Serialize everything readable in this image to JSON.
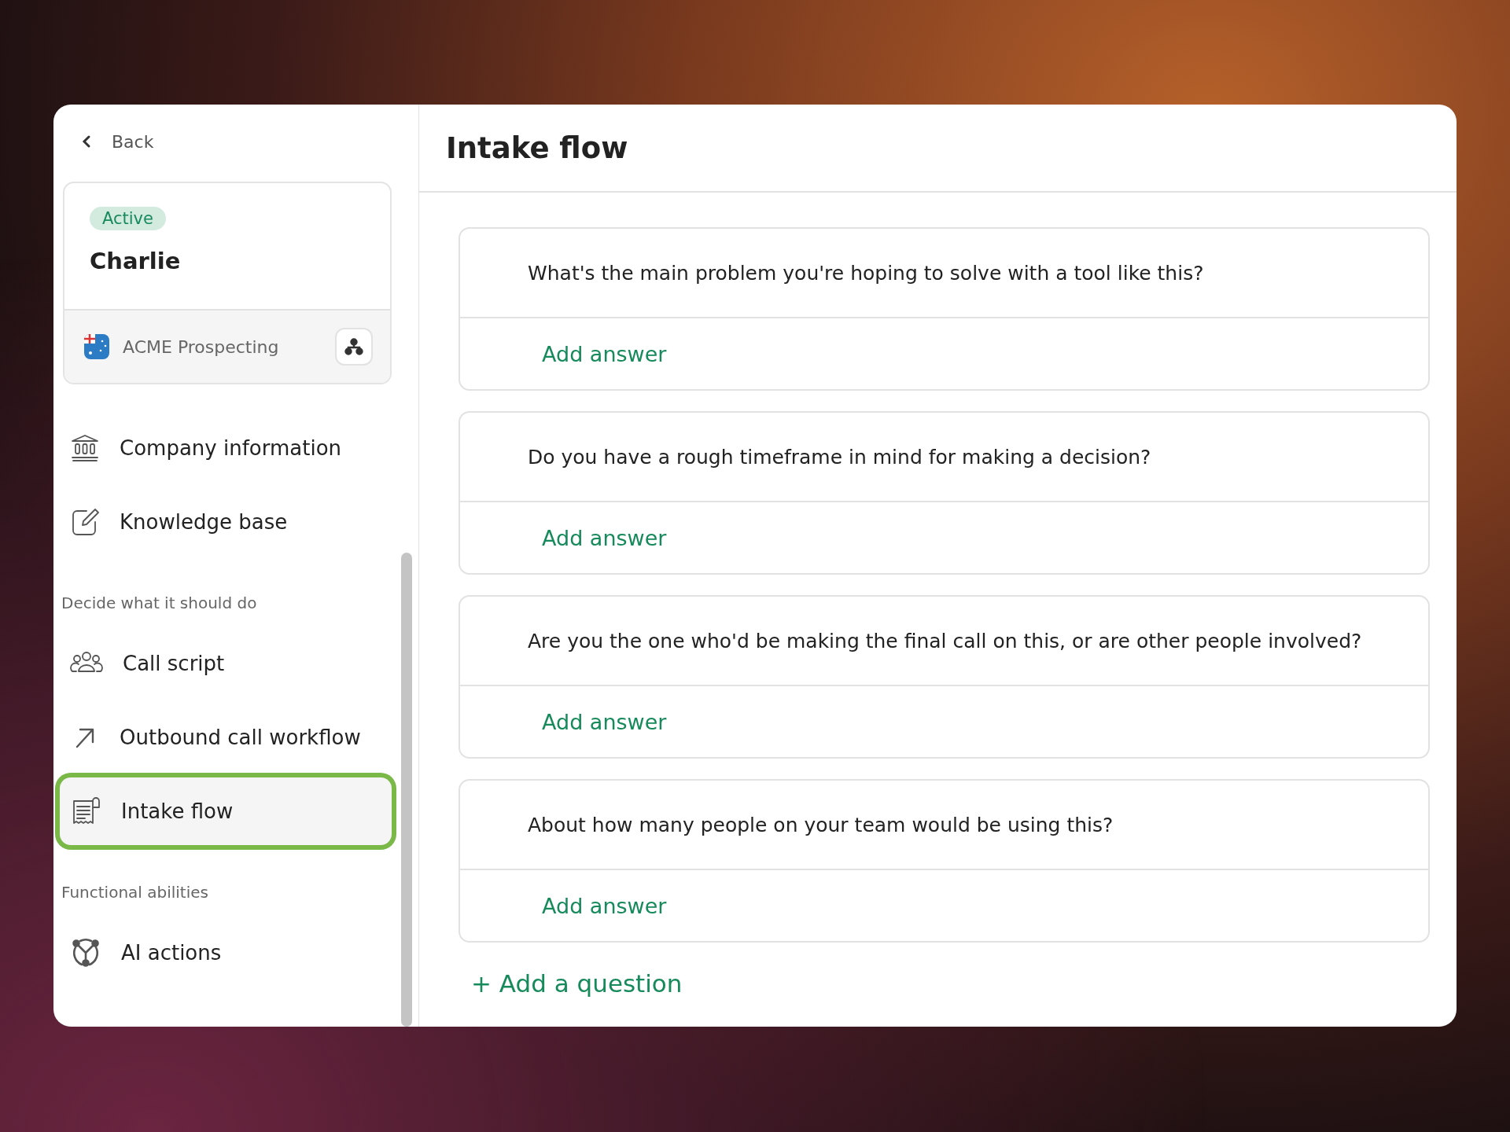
{
  "back": {
    "label": "Back"
  },
  "agent": {
    "status": "Active",
    "name": "Charlie",
    "account": "ACME Prospecting"
  },
  "sections": [
    {
      "items": [
        {
          "label": "Company information",
          "selected": false
        },
        {
          "label": "Knowledge base",
          "selected": false
        }
      ]
    },
    {
      "label": "Decide what it should do",
      "items": [
        {
          "label": "Call script",
          "selected": false
        },
        {
          "label": "Outbound call workflow",
          "selected": false
        },
        {
          "label": "Intake flow",
          "selected": true
        }
      ]
    },
    {
      "label": "Functional abilities",
      "items": [
        {
          "label": "AI actions",
          "selected": false
        }
      ]
    }
  ],
  "page": {
    "title": "Intake flow"
  },
  "questions": [
    {
      "question": "What's the main problem you're hoping to solve with a tool like this?",
      "action": "Add answer"
    },
    {
      "question": "Do you have a rough timeframe in mind for making a decision?",
      "action": "Add answer"
    },
    {
      "question": "Are you the one who'd be making the final call on this, or are other people involved?",
      "action": "Add answer"
    },
    {
      "question": "About how many people on your team would be using this?",
      "action": "Add answer"
    }
  ],
  "add_question": "+ Add a question"
}
